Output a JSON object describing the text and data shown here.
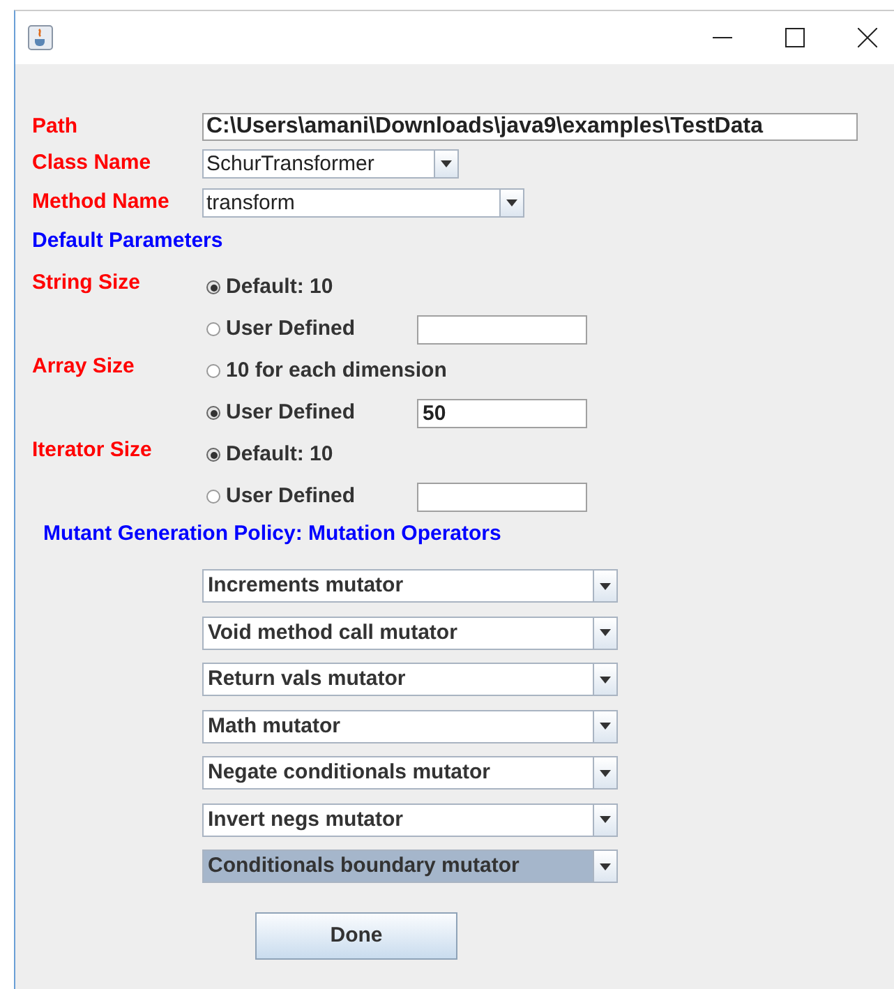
{
  "fields": [
    {
      "label": "Path",
      "kind": "text",
      "value": "C:\\Users\\amani\\Downloads\\java9\\examples\\TestData"
    },
    {
      "label": "Class Name",
      "kind": "combo",
      "value": "SchurTransformer"
    },
    {
      "label": "Method Name",
      "kind": "combo",
      "value": "transform"
    }
  ],
  "defaults_heading": "Default Parameters",
  "parameters": [
    {
      "label": "String Size",
      "options": [
        {
          "label": "Default: 10",
          "selected": true,
          "kind": "plain"
        },
        {
          "label": "User Defined",
          "selected": false,
          "kind": "field"
        }
      ]
    },
    {
      "label": "Array Size",
      "options": [
        {
          "label": "10 for each dimension",
          "selected": false,
          "kind": "plain"
        },
        {
          "label": "User Defined",
          "selected": true,
          "kind": "field",
          "value": "50"
        }
      ]
    },
    {
      "label": "Iterator Size",
      "options": [
        {
          "label": "Default: 10",
          "selected": true,
          "kind": "plain"
        },
        {
          "label": "User Defined",
          "selected": false,
          "kind": "field"
        }
      ]
    }
  ],
  "policy_heading": "Mutant Generation Policy: Mutation Operators",
  "operators": [
    {
      "value": "Increments mutator",
      "selected": false
    },
    {
      "value": "Void method call mutator",
      "selected": false
    },
    {
      "value": "Return vals mutator",
      "selected": false
    },
    {
      "value": "Math mutator",
      "selected": false
    },
    {
      "value": "Negate conditionals mutator",
      "selected": false
    },
    {
      "value": "Invert negs mutator",
      "selected": false
    },
    {
      "value": "Conditionals boundary mutator",
      "selected": true
    }
  ],
  "done_button": "Done"
}
